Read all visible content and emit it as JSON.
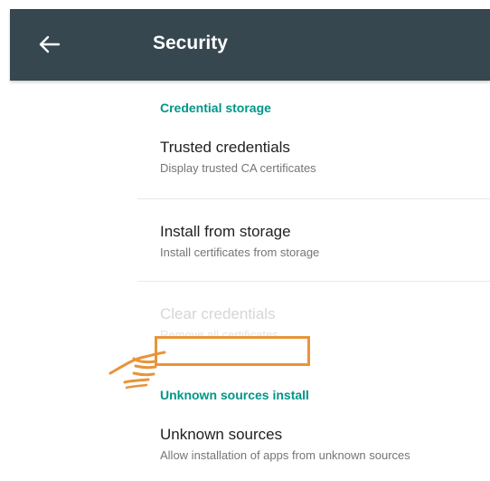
{
  "toolbar": {
    "title": "Security",
    "back_icon": "arrow-back-icon",
    "background": "#37474f"
  },
  "sections": {
    "credential_storage": {
      "header": "Credential storage",
      "items": [
        {
          "title": "Trusted credentials",
          "summary": "Display trusted CA certificates",
          "enabled": true
        },
        {
          "title": "Install from storage",
          "summary": "Install certificates from storage",
          "enabled": true
        },
        {
          "title": "Clear credentials",
          "summary": "Remove all certificates",
          "enabled": false
        }
      ]
    },
    "unknown_sources": {
      "header": "Unknown sources install",
      "items": [
        {
          "title": "Unknown sources",
          "summary": "Allow installation of apps from unknown sources",
          "enabled": true,
          "highlighted": true
        }
      ]
    }
  },
  "colors": {
    "accent": "#009688",
    "highlight": "#e8943a",
    "disabled_text": "#d6d6d6"
  },
  "annotation": {
    "pointer_icon": "pointing-hand-icon"
  }
}
